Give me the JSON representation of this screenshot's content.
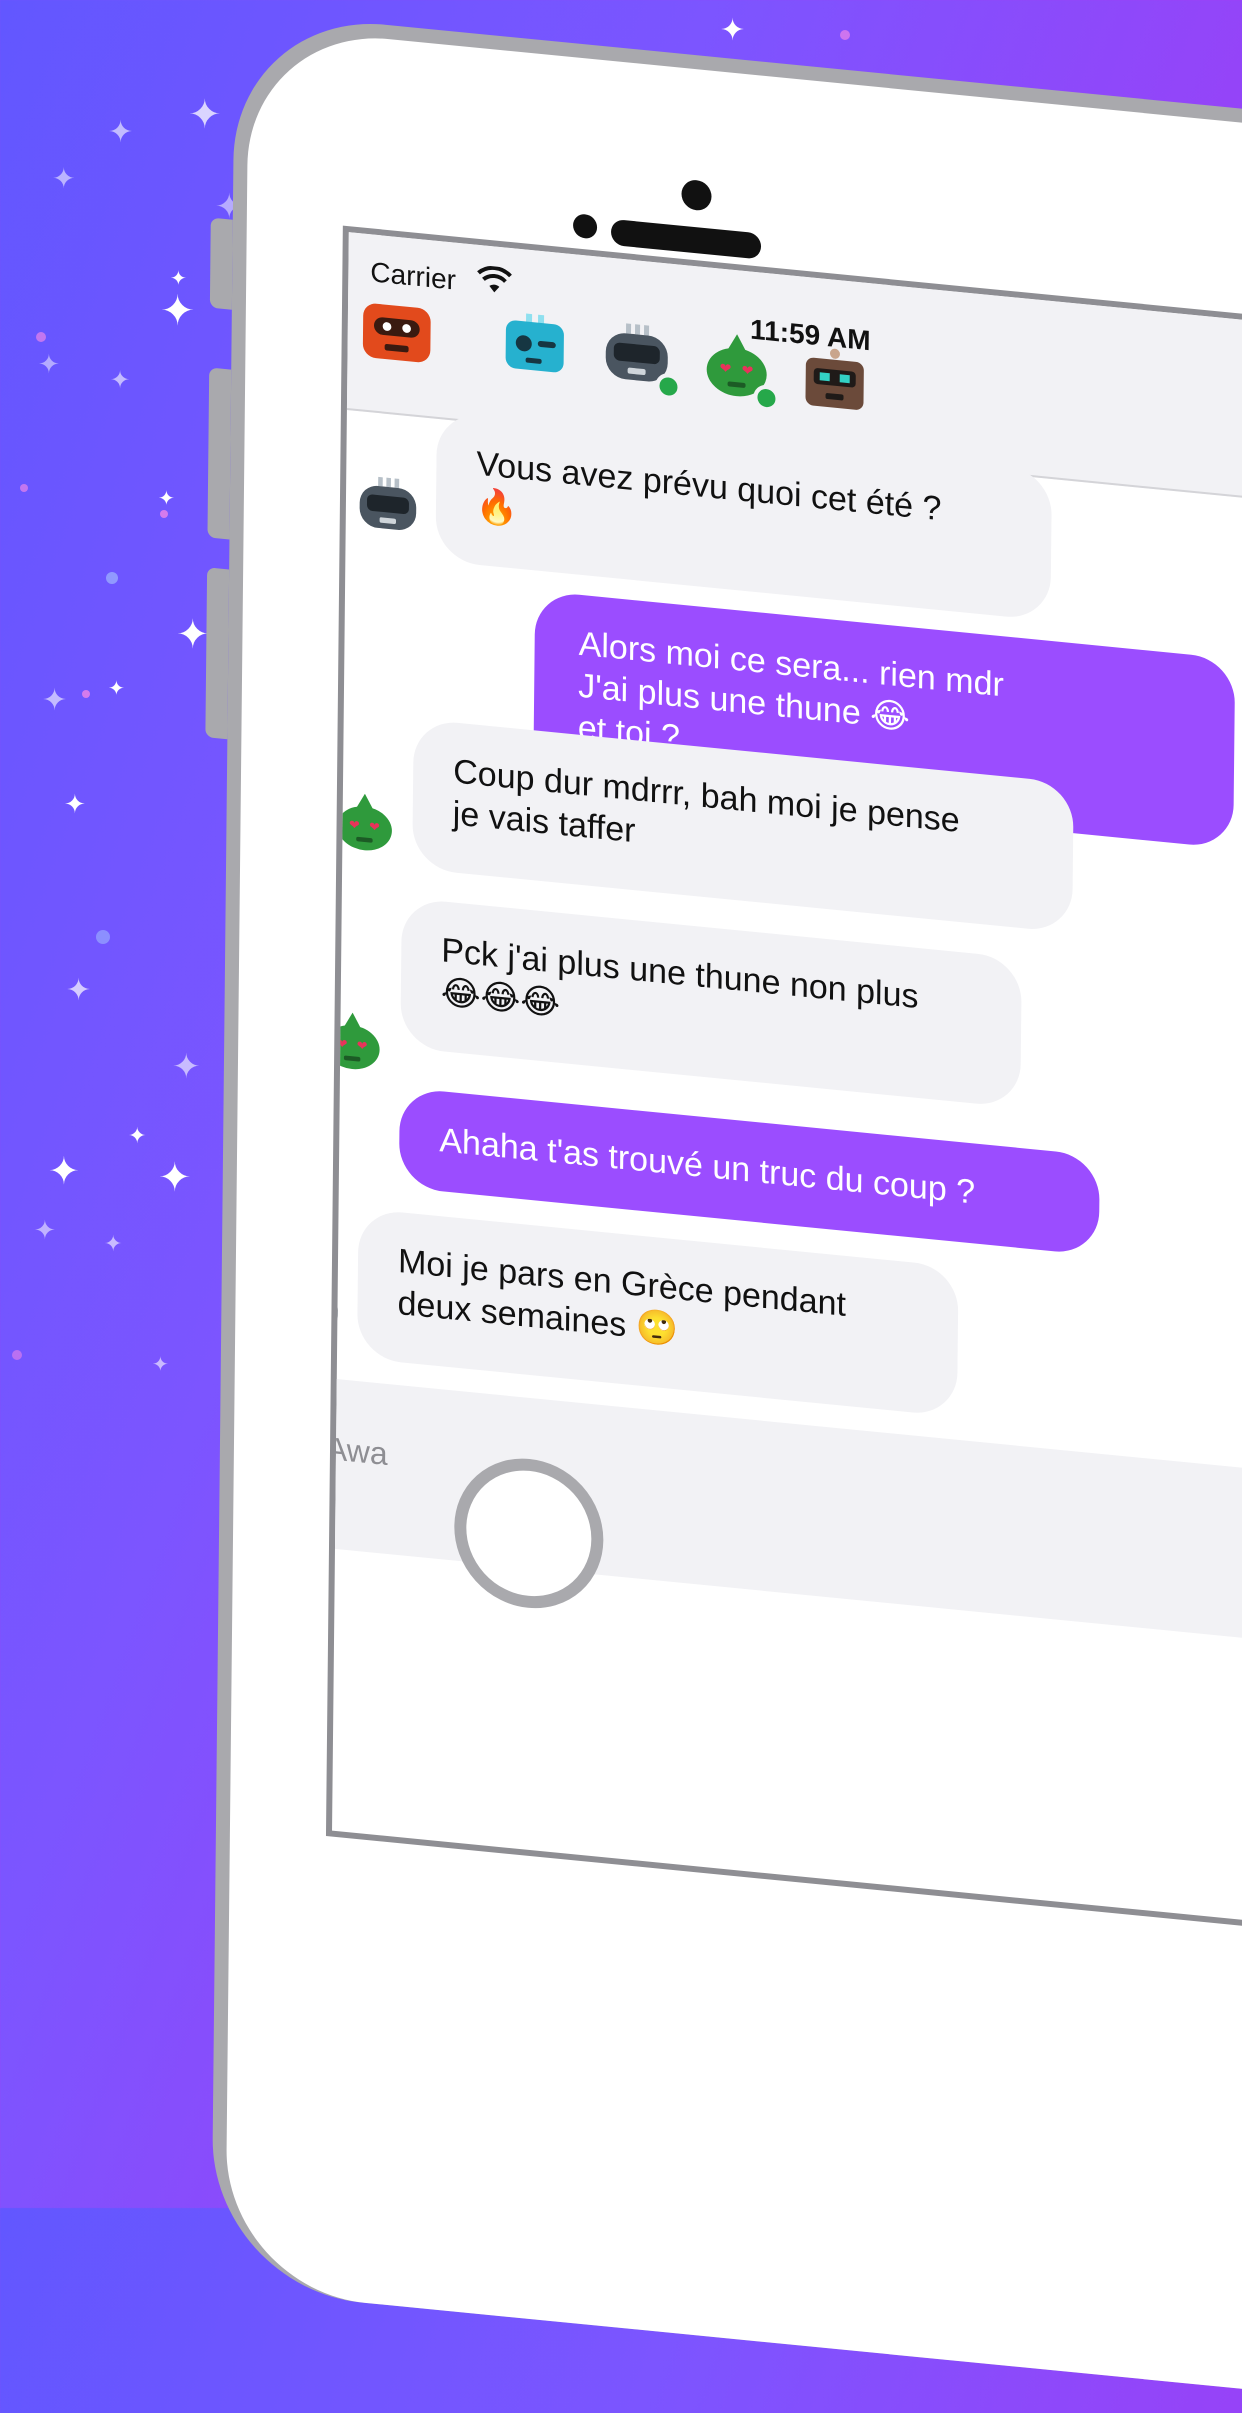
{
  "status_bar": {
    "carrier": "Carrier",
    "time": "11:59 AM"
  },
  "contacts": [
    {
      "id": "robot-red",
      "color": "#e24a1c",
      "online": false
    },
    {
      "id": "robot-cyan",
      "color": "#26b1cf",
      "online": false
    },
    {
      "id": "robot-gray",
      "color": "#4a5560",
      "online": true
    },
    {
      "id": "robot-green",
      "color": "#2f9a3c",
      "online": true
    },
    {
      "id": "robot-brown",
      "color": "#6b4a3a",
      "online": false
    }
  ],
  "messages": [
    {
      "direction": "in",
      "sender": "robot-gray",
      "text": "Vous avez prévu quoi cet été ?\n🔥"
    },
    {
      "direction": "out",
      "text": "Alors moi ce sera... rien mdr\nJ'ai plus une thune 😂\net toi ?"
    },
    {
      "direction": "in",
      "sender": "robot-green",
      "text": "Coup dur mdrrr, bah moi je pense\nje vais taffer"
    },
    {
      "direction": "in",
      "sender": "robot-green",
      "text": "Pck j'ai plus une thune non plus\n😂😂😂"
    },
    {
      "direction": "out",
      "text": "Ahaha t'as trouvé un truc du coup ?"
    },
    {
      "direction": "in",
      "sender": "robot-gray",
      "text": "Moi je pars en Grèce pendant\ndeux semaines 🙄"
    }
  ],
  "composer": {
    "value": "Awa"
  },
  "colors": {
    "accent": "#9b4dff",
    "incoming_bubble": "#f2f2f5",
    "online": "#26a84a",
    "background_start": "#6257ff",
    "background_end": "#c12df0"
  }
}
